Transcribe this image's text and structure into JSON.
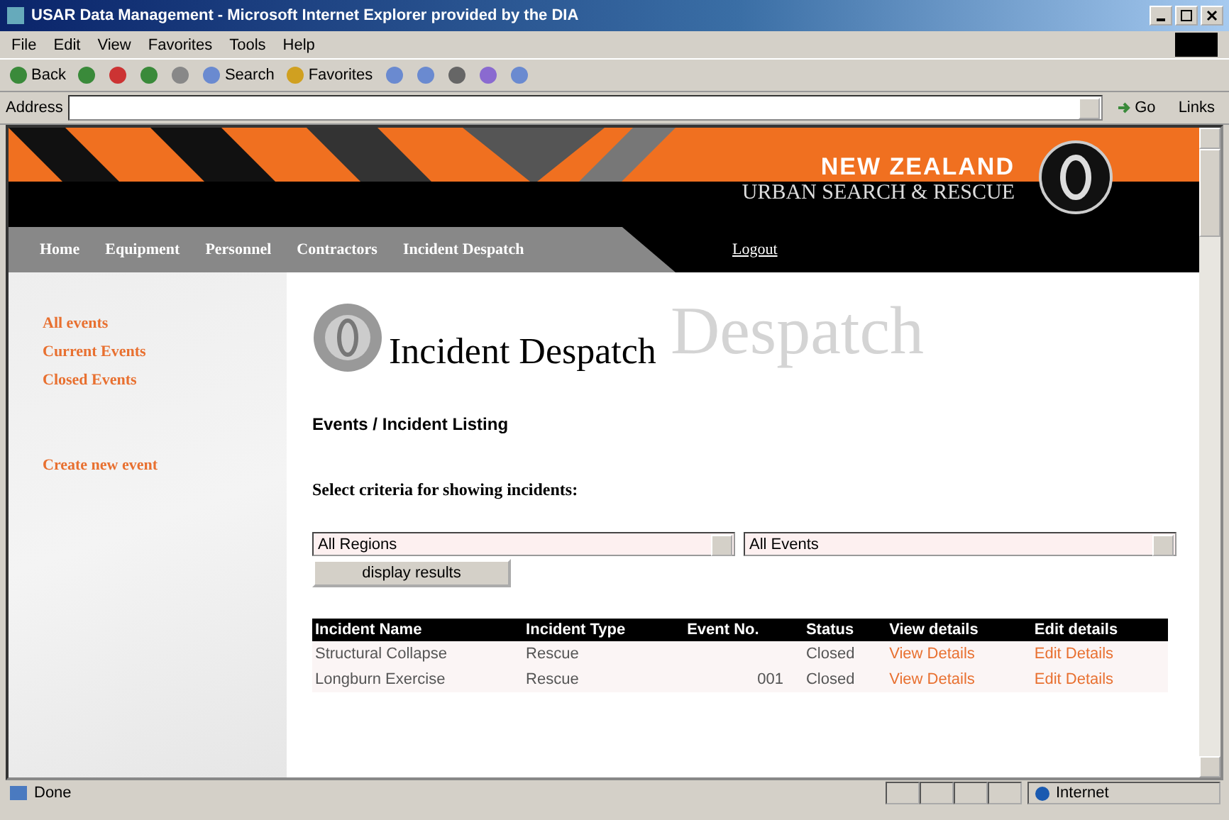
{
  "window": {
    "title": "USAR Data Management - Microsoft Internet Explorer provided by the DIA"
  },
  "menu": [
    "File",
    "Edit",
    "View",
    "Favorites",
    "Tools",
    "Help"
  ],
  "toolbar": [
    {
      "kind": "back",
      "label": "Back"
    },
    {
      "kind": "forward"
    },
    {
      "kind": "stop"
    },
    {
      "kind": "refresh"
    },
    {
      "kind": "home"
    },
    {
      "kind": "search",
      "label": "Search"
    },
    {
      "kind": "favorites",
      "label": "Favorites"
    },
    {
      "kind": "history"
    },
    {
      "kind": "mail"
    },
    {
      "kind": "print"
    },
    {
      "kind": "edit"
    },
    {
      "kind": "discuss"
    }
  ],
  "address": {
    "label": "Address",
    "go": "Go",
    "links": "Links"
  },
  "banner": {
    "line1": "NEW ZEALAND",
    "line2": "URBAN SEARCH & RESCUE"
  },
  "nav": [
    {
      "label": "Home"
    },
    {
      "label": "Equipment"
    },
    {
      "label": "Personnel"
    },
    {
      "label": "Contractors"
    },
    {
      "label": "Incident Despatch"
    }
  ],
  "logout": "Logout",
  "sidebar": {
    "items": [
      "All events",
      "Current Events",
      "Closed Events"
    ],
    "create": "Create new event"
  },
  "page": {
    "watermark": "Despatch",
    "title": "Incident Despatch",
    "section": "Events / Incident Listing",
    "criteria": "Select criteria for showing incidents:"
  },
  "filters": [
    {
      "value": "All Regions"
    },
    {
      "value": "All Events"
    }
  ],
  "display_button": "display results",
  "table": {
    "columns": [
      "Incident Name",
      "Incident Type",
      "Event No.",
      "Status",
      "View details",
      "Edit details"
    ],
    "rows": [
      {
        "name": "Structural Collapse",
        "type": "Rescue",
        "event_no": "",
        "status": "Closed",
        "view": "View Details",
        "edit": "Edit Details"
      },
      {
        "name": "Longburn Exercise",
        "type": "Rescue",
        "event_no": "001",
        "status": "Closed",
        "view": "View Details",
        "edit": "Edit Details"
      }
    ]
  },
  "status_bar": {
    "text": "Done",
    "zone": "Internet"
  }
}
